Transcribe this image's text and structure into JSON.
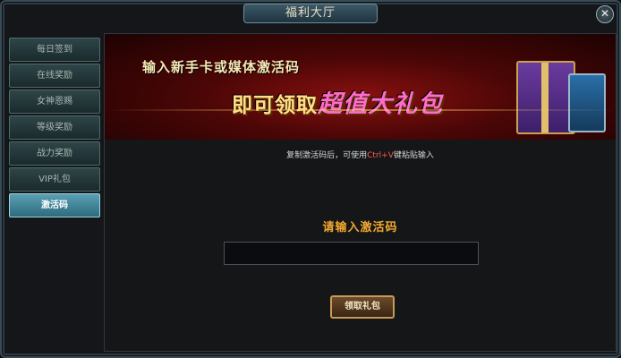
{
  "window": {
    "title": "福利大厅",
    "close_label": "✕"
  },
  "sidebar": {
    "items": [
      {
        "label": "每日签到"
      },
      {
        "label": "在线奖励"
      },
      {
        "label": "女神恩赐"
      },
      {
        "label": "等级奖励"
      },
      {
        "label": "战力奖励"
      },
      {
        "label": "VIP礼包"
      },
      {
        "label": "激活码",
        "active": true
      }
    ]
  },
  "banner": {
    "line1": "输入新手卡或媒体激活码",
    "line2_prefix": "即可领取",
    "line2_highlight": "超值大礼包"
  },
  "hint": {
    "before": "复制激活码后，可使用",
    "key": "Ctrl+V",
    "after": "键粘贴输入"
  },
  "form": {
    "prompt": "请输入激活码",
    "code_value": "",
    "claim_label": "领取礼包"
  }
}
